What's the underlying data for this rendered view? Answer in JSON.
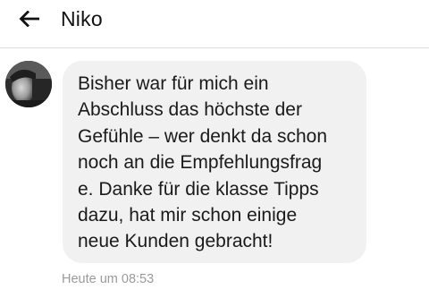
{
  "header": {
    "back_icon": "arrow-left-icon",
    "title": "Niko"
  },
  "conversation": {
    "sender_avatar_icon": "user-avatar-photo",
    "message": {
      "text": "Bisher war für mich ein\nAbschluss das höchste der\nGefühle – wer denkt da schon\nnoch an die Empfehlungsfrag\ne. Danke für die klasse Tipps\ndazu, hat mir schon einige\nneue Kunden gebracht!",
      "timestamp": "Heute um 08:53"
    }
  },
  "colors": {
    "bubble_background": "#f1f1f1",
    "timestamp_text": "#9a9a9a",
    "divider": "#dcdcdc"
  }
}
